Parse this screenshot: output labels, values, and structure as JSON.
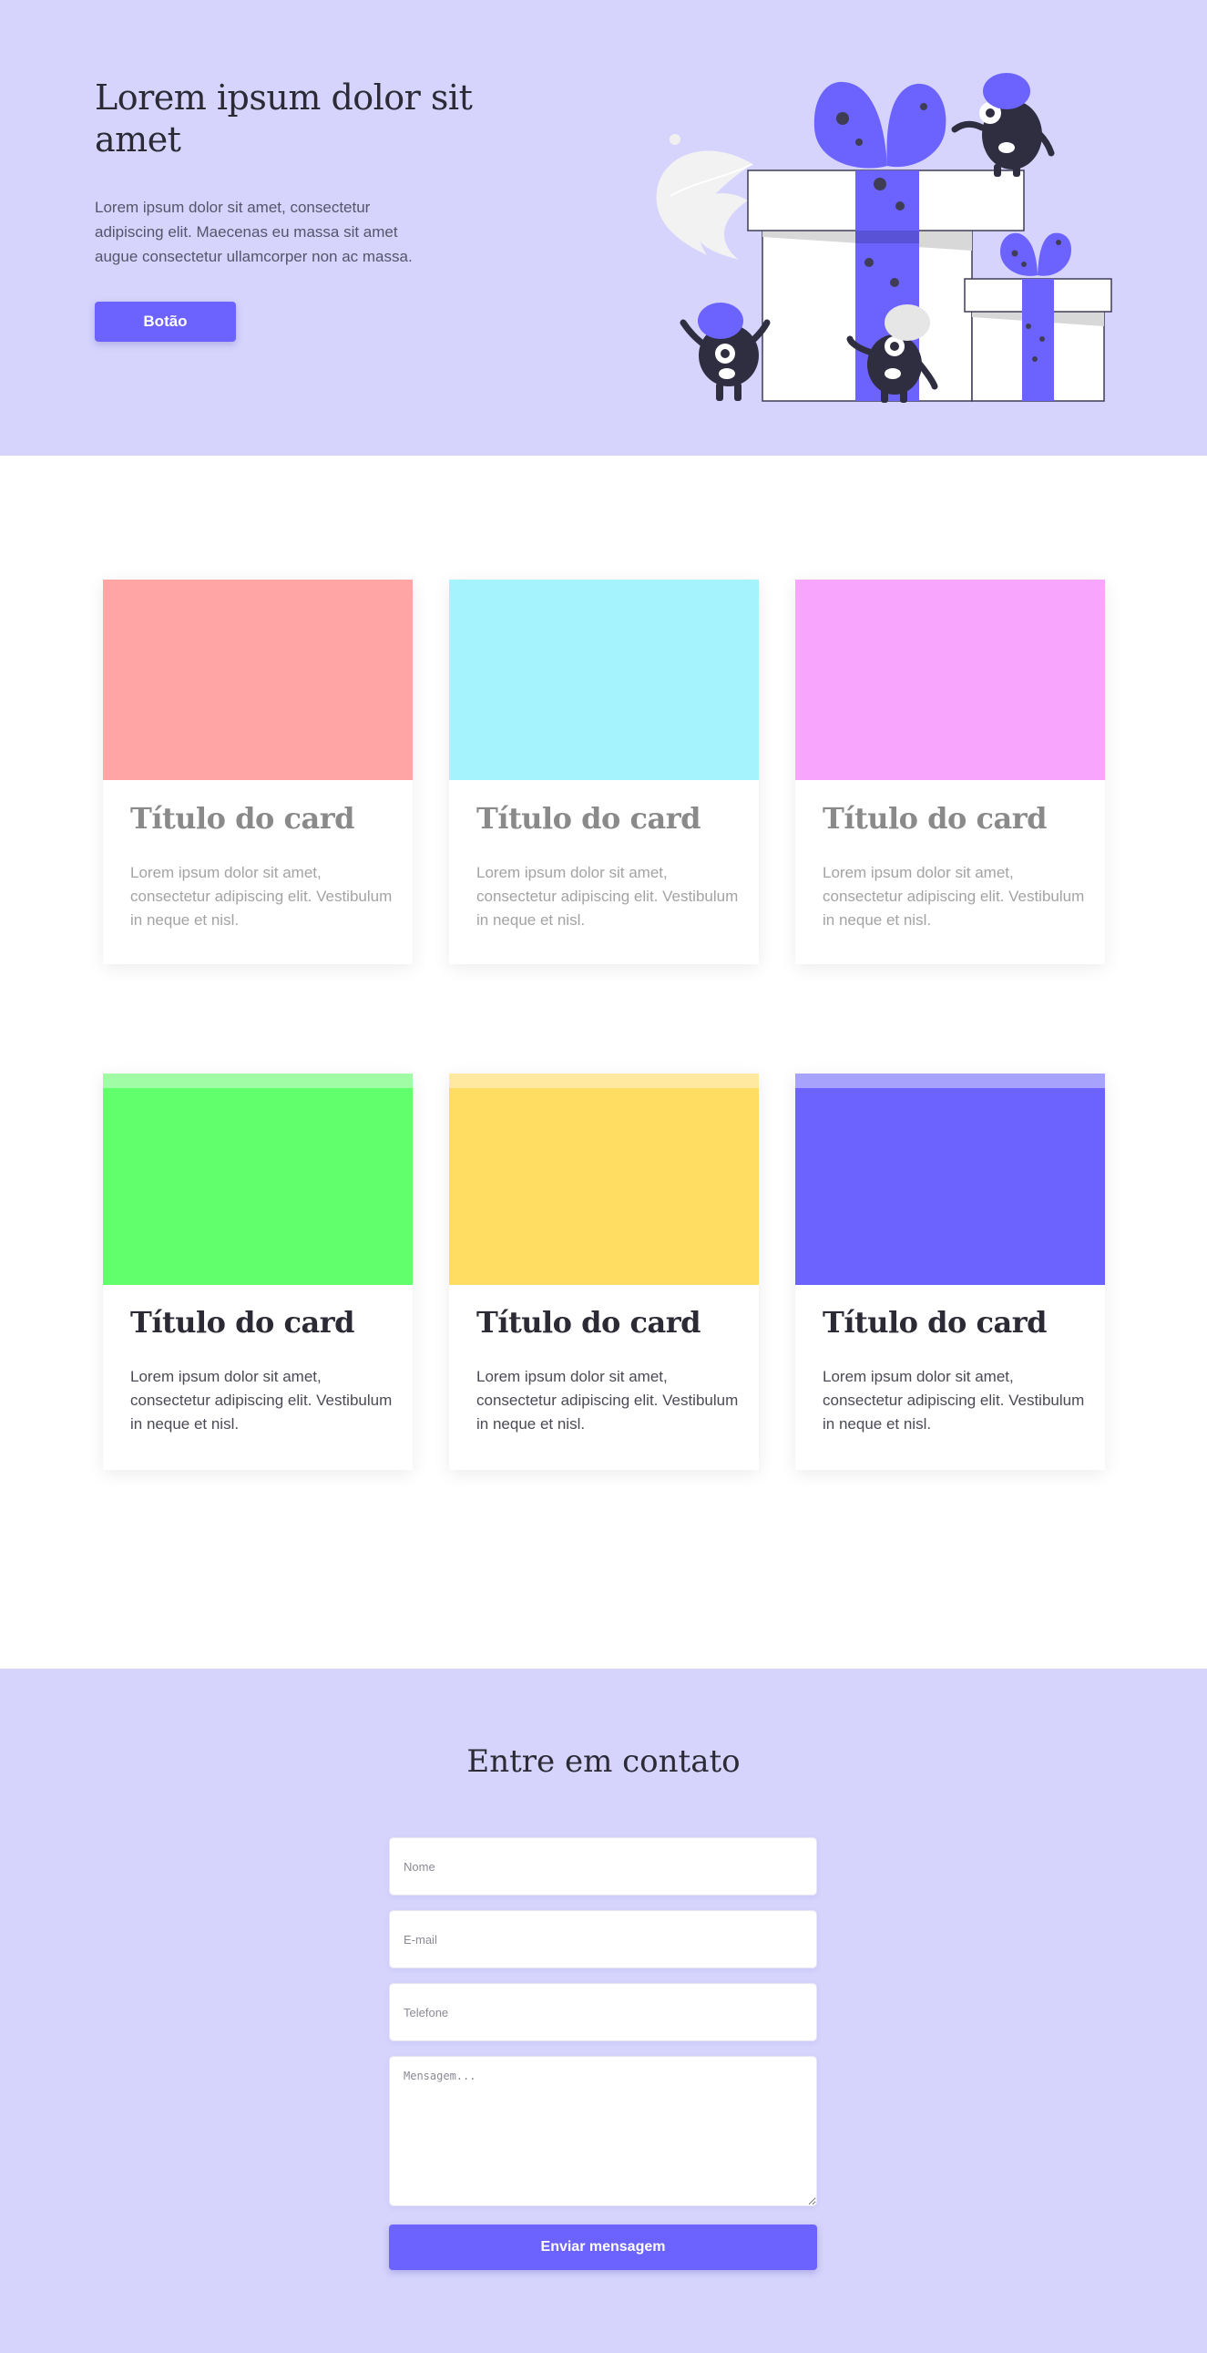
{
  "hero": {
    "title": "Lorem ipsum dolor sit amet",
    "text": "Lorem ipsum dolor sit amet, consectetur adipiscing elit. Maecenas eu massa sit amet augue consectetur ullamcorper non ac massa.",
    "button_label": "Botão",
    "accent_color": "#6c63ff",
    "background_color": "#d6d4fd",
    "illustration": "gift-boxes-with-monsters"
  },
  "cards_row1": [
    {
      "title": "Título do card",
      "text": "Lorem ipsum dolor sit amet, consectetur adipiscing elit. Vestibulum in neque et nisl.",
      "color": "#ffa5a5"
    },
    {
      "title": "Título do card",
      "text": "Lorem ipsum dolor sit amet, consectetur adipiscing elit. Vestibulum in neque et nisl.",
      "color": "#a5f3fd"
    },
    {
      "title": "Título do card",
      "text": "Lorem ipsum dolor sit amet, consectetur adipiscing elit. Vestibulum in neque et nisl.",
      "color": "#f8a5fd"
    }
  ],
  "cards_row2": [
    {
      "title": "Título do card",
      "text": "Lorem ipsum dolor sit amet, consectetur adipiscing elit. Vestibulum in neque et nisl.",
      "color": "#62ff6c",
      "top_color": "#a1fca6"
    },
    {
      "title": "Título do card",
      "text": "Lorem ipsum dolor sit amet, consectetur adipiscing elit. Vestibulum in neque et nisl.",
      "color": "#ffdc62",
      "top_color": "#ffe9a1"
    },
    {
      "title": "Título do card",
      "text": "Lorem ipsum dolor sit amet, consectetur adipiscing elit. Vestibulum in neque et nisl.",
      "color": "#6c63ff",
      "top_color": "#a7a2fb"
    }
  ],
  "contact": {
    "title": "Entre em contato",
    "name_placeholder": "Nome",
    "email_placeholder": "E-mail",
    "phone_placeholder": "Telefone",
    "message_placeholder": "Mensagem...",
    "submit_label": "Enviar mensagem"
  }
}
